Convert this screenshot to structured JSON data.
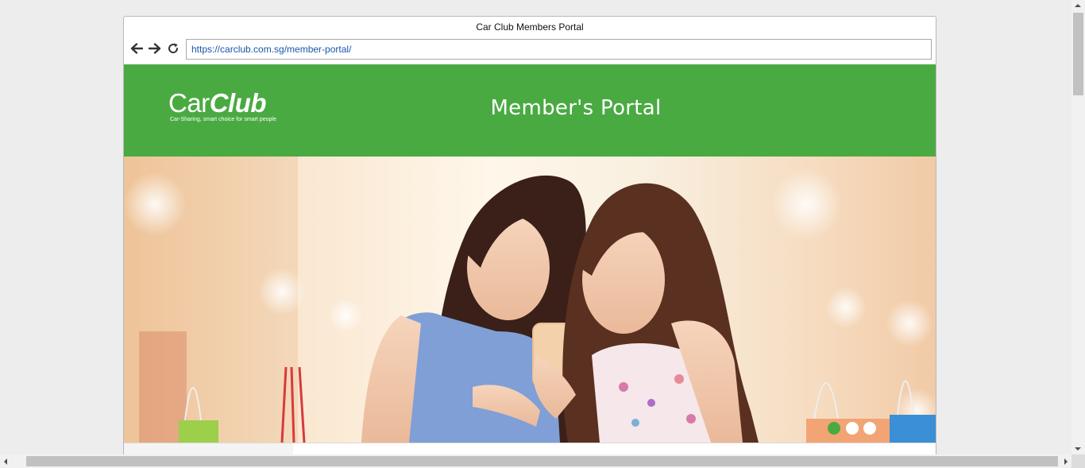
{
  "window": {
    "title": "Car Club Members Portal",
    "url": "https://carclub.com.sg/member-portal/"
  },
  "nav": {
    "back_icon": "arrow-left-icon",
    "forward_icon": "arrow-right-icon",
    "reload_icon": "reload-icon"
  },
  "header": {
    "logo_car": "Car",
    "logo_club": "Club",
    "logo_tagline": "Car-Sharing, smart choice for smart people",
    "title": "Member's Portal",
    "background_color": "#4aaa42"
  },
  "hero": {
    "slides": 3,
    "active_slide": 1,
    "dot_active_color": "#4aaa42",
    "dot_inactive_color": "#ffffff"
  }
}
